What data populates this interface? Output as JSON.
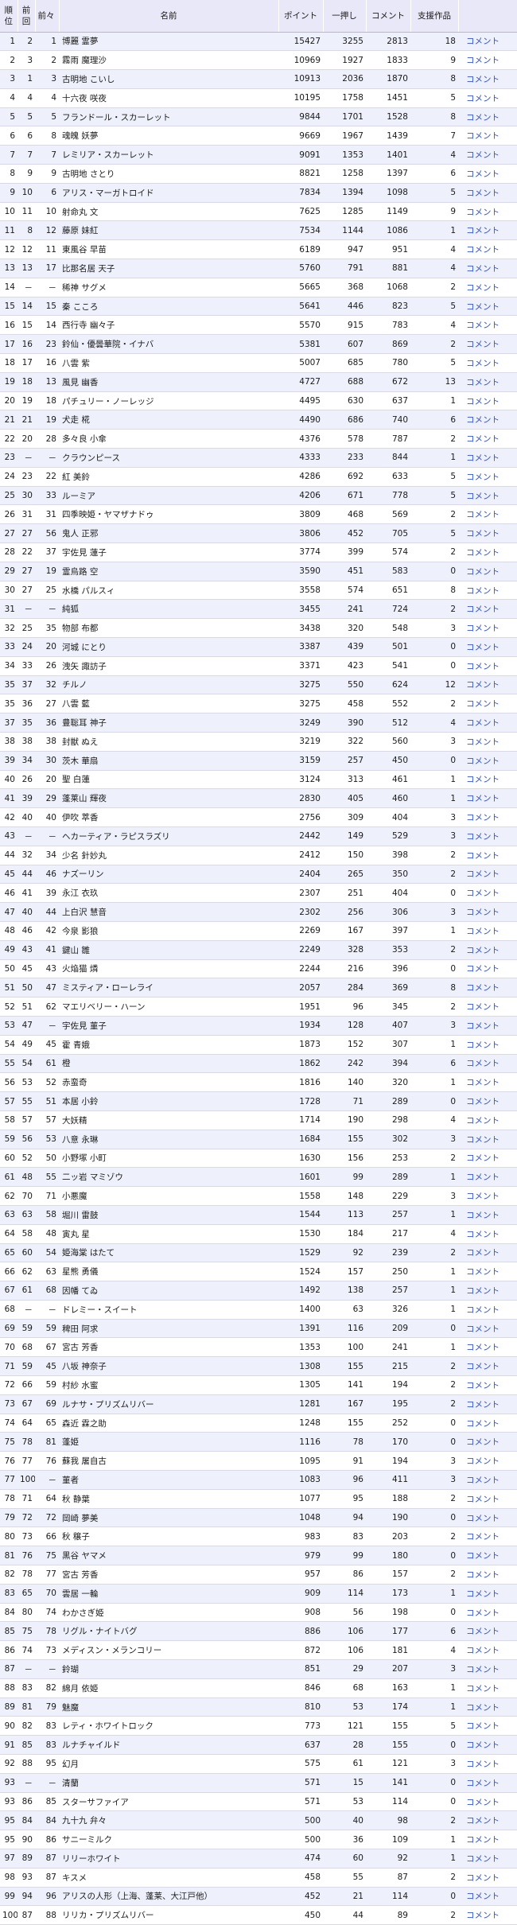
{
  "header": {
    "rank": "順位",
    "prev": "前回",
    "prev2": "前々",
    "name": "名前",
    "points": "ポイント",
    "push": "一押し",
    "comments": "コメント",
    "works": "支援作品"
  },
  "link_label": "コメント",
  "rows": [
    [
      "1",
      "2",
      "1",
      "博麗 霊夢",
      "15427",
      "3255",
      "2813",
      "18"
    ],
    [
      "2",
      "3",
      "2",
      "霧雨 魔理沙",
      "10969",
      "1927",
      "1833",
      "9"
    ],
    [
      "3",
      "1",
      "3",
      "古明地 こいし",
      "10913",
      "2036",
      "1870",
      "8"
    ],
    [
      "4",
      "4",
      "4",
      "十六夜 咲夜",
      "10195",
      "1758",
      "1451",
      "5"
    ],
    [
      "5",
      "5",
      "5",
      "フランドール・スカーレット",
      "9844",
      "1701",
      "1528",
      "8"
    ],
    [
      "6",
      "6",
      "8",
      "魂魄 妖夢",
      "9669",
      "1967",
      "1439",
      "7"
    ],
    [
      "7",
      "7",
      "7",
      "レミリア・スカーレット",
      "9091",
      "1353",
      "1401",
      "4"
    ],
    [
      "8",
      "9",
      "9",
      "古明地 さとり",
      "8821",
      "1258",
      "1397",
      "6"
    ],
    [
      "9",
      "10",
      "6",
      "アリス・マーガトロイド",
      "7834",
      "1394",
      "1098",
      "5"
    ],
    [
      "10",
      "11",
      "10",
      "射命丸 文",
      "7625",
      "1285",
      "1149",
      "9"
    ],
    [
      "11",
      "8",
      "12",
      "藤原 妹紅",
      "7534",
      "1144",
      "1086",
      "1"
    ],
    [
      "12",
      "12",
      "11",
      "東風谷 早苗",
      "6189",
      "947",
      "951",
      "4"
    ],
    [
      "13",
      "13",
      "17",
      "比那名居 天子",
      "5760",
      "791",
      "881",
      "4"
    ],
    [
      "14",
      "－",
      "－",
      "稀神 サグメ",
      "5665",
      "368",
      "1068",
      "2"
    ],
    [
      "15",
      "14",
      "15",
      "秦 こころ",
      "5641",
      "446",
      "823",
      "5"
    ],
    [
      "16",
      "15",
      "14",
      "西行寺 幽々子",
      "5570",
      "915",
      "783",
      "4"
    ],
    [
      "17",
      "16",
      "23",
      "鈴仙・優曇華院・イナバ",
      "5381",
      "607",
      "869",
      "2"
    ],
    [
      "18",
      "17",
      "16",
      "八雲 紫",
      "5007",
      "685",
      "780",
      "5"
    ],
    [
      "19",
      "18",
      "13",
      "風見 幽香",
      "4727",
      "688",
      "672",
      "13"
    ],
    [
      "20",
      "19",
      "18",
      "パチュリー・ノーレッジ",
      "4495",
      "630",
      "637",
      "1"
    ],
    [
      "21",
      "21",
      "19",
      "犬走 椛",
      "4490",
      "686",
      "740",
      "6"
    ],
    [
      "22",
      "20",
      "28",
      "多々良 小傘",
      "4376",
      "578",
      "787",
      "2"
    ],
    [
      "23",
      "－",
      "－",
      "クラウンピース",
      "4333",
      "233",
      "844",
      "1"
    ],
    [
      "24",
      "23",
      "22",
      "紅 美鈴",
      "4286",
      "692",
      "633",
      "5"
    ],
    [
      "25",
      "30",
      "33",
      "ルーミア",
      "4206",
      "671",
      "778",
      "5"
    ],
    [
      "26",
      "31",
      "31",
      "四季映姫・ヤマザナドゥ",
      "3809",
      "468",
      "569",
      "2"
    ],
    [
      "27",
      "27",
      "56",
      "鬼人 正邪",
      "3806",
      "452",
      "705",
      "5"
    ],
    [
      "28",
      "22",
      "37",
      "宇佐見 蓮子",
      "3774",
      "399",
      "574",
      "2"
    ],
    [
      "29",
      "27",
      "19",
      "霊烏路 空",
      "3590",
      "451",
      "583",
      "0"
    ],
    [
      "30",
      "27",
      "25",
      "水橋 パルスィ",
      "3558",
      "574",
      "651",
      "8"
    ],
    [
      "31",
      "－",
      "－",
      "純狐",
      "3455",
      "241",
      "724",
      "2"
    ],
    [
      "32",
      "25",
      "35",
      "物部 布都",
      "3438",
      "320",
      "548",
      "3"
    ],
    [
      "33",
      "24",
      "20",
      "河城 にとり",
      "3387",
      "439",
      "501",
      "0"
    ],
    [
      "34",
      "33",
      "26",
      "洩矢 諏訪子",
      "3371",
      "423",
      "541",
      "0"
    ],
    [
      "35",
      "37",
      "32",
      "チルノ",
      "3275",
      "550",
      "624",
      "12"
    ],
    [
      "35",
      "36",
      "27",
      "八雲 藍",
      "3275",
      "458",
      "552",
      "2"
    ],
    [
      "37",
      "35",
      "36",
      "豊聡耳 神子",
      "3249",
      "390",
      "512",
      "4"
    ],
    [
      "38",
      "38",
      "38",
      "封獣 ぬえ",
      "3219",
      "322",
      "560",
      "3"
    ],
    [
      "39",
      "34",
      "30",
      "茨木 華扇",
      "3159",
      "257",
      "450",
      "0"
    ],
    [
      "40",
      "26",
      "20",
      "聖 白蓮",
      "3124",
      "313",
      "461",
      "1"
    ],
    [
      "41",
      "39",
      "29",
      "蓬莱山 輝夜",
      "2830",
      "405",
      "460",
      "1"
    ],
    [
      "42",
      "40",
      "40",
      "伊吹 萃香",
      "2756",
      "309",
      "404",
      "3"
    ],
    [
      "43",
      "－",
      "－",
      "ヘカーティア・ラピスラズリ",
      "2442",
      "149",
      "529",
      "3"
    ],
    [
      "44",
      "32",
      "34",
      "少名 針妙丸",
      "2412",
      "150",
      "398",
      "2"
    ],
    [
      "45",
      "44",
      "46",
      "ナズーリン",
      "2404",
      "265",
      "350",
      "2"
    ],
    [
      "46",
      "41",
      "39",
      "永江 衣玖",
      "2307",
      "251",
      "404",
      "0"
    ],
    [
      "47",
      "40",
      "44",
      "上白沢 慧音",
      "2302",
      "256",
      "306",
      "3"
    ],
    [
      "48",
      "46",
      "42",
      "今泉 影狼",
      "2269",
      "167",
      "397",
      "1"
    ],
    [
      "49",
      "43",
      "41",
      "鍵山 雛",
      "2249",
      "328",
      "353",
      "2"
    ],
    [
      "50",
      "45",
      "43",
      "火焔猫 燐",
      "2244",
      "216",
      "396",
      "0"
    ],
    [
      "51",
      "50",
      "47",
      "ミスティア・ローレライ",
      "2057",
      "284",
      "369",
      "8"
    ],
    [
      "52",
      "51",
      "62",
      "マエリベリー・ハーン",
      "1951",
      "96",
      "345",
      "2"
    ],
    [
      "53",
      "47",
      "－",
      "宇佐見 菫子",
      "1934",
      "128",
      "407",
      "3"
    ],
    [
      "54",
      "49",
      "45",
      "霍 青娥",
      "1873",
      "152",
      "307",
      "1"
    ],
    [
      "55",
      "54",
      "61",
      "橙",
      "1862",
      "242",
      "394",
      "6"
    ],
    [
      "56",
      "53",
      "52",
      "赤蛮奇",
      "1816",
      "140",
      "320",
      "1"
    ],
    [
      "57",
      "55",
      "51",
      "本居 小鈴",
      "1728",
      "71",
      "289",
      "0"
    ],
    [
      "58",
      "57",
      "57",
      "大妖精",
      "1714",
      "190",
      "298",
      "4"
    ],
    [
      "59",
      "56",
      "53",
      "八意 永琳",
      "1684",
      "155",
      "302",
      "3"
    ],
    [
      "60",
      "52",
      "50",
      "小野塚 小町",
      "1630",
      "156",
      "253",
      "2"
    ],
    [
      "61",
      "48",
      "55",
      "二ッ岩 マミゾウ",
      "1601",
      "99",
      "289",
      "1"
    ],
    [
      "62",
      "70",
      "71",
      "小悪魔",
      "1558",
      "148",
      "229",
      "3"
    ],
    [
      "63",
      "63",
      "58",
      "堀川 雷鼓",
      "1544",
      "113",
      "257",
      "1"
    ],
    [
      "64",
      "58",
      "48",
      "寅丸 星",
      "1530",
      "184",
      "217",
      "4"
    ],
    [
      "65",
      "60",
      "54",
      "姫海棠 はたて",
      "1529",
      "92",
      "239",
      "2"
    ],
    [
      "66",
      "62",
      "63",
      "星熊 勇儀",
      "1524",
      "157",
      "250",
      "1"
    ],
    [
      "67",
      "61",
      "68",
      "因幡 てゐ",
      "1492",
      "138",
      "257",
      "1"
    ],
    [
      "68",
      "－",
      "－",
      "ドレミー・スイート",
      "1400",
      "63",
      "326",
      "1"
    ],
    [
      "69",
      "59",
      "59",
      "稗田 阿求",
      "1391",
      "116",
      "209",
      "0"
    ],
    [
      "70",
      "68",
      "67",
      "宮古 芳香",
      "1353",
      "100",
      "241",
      "1"
    ],
    [
      "71",
      "59",
      "45",
      "八坂 神奈子",
      "1308",
      "155",
      "215",
      "2"
    ],
    [
      "72",
      "66",
      "59",
      "村紗 水蜜",
      "1305",
      "141",
      "194",
      "2"
    ],
    [
      "73",
      "67",
      "69",
      "ルナサ・プリズムリバー",
      "1281",
      "167",
      "195",
      "2"
    ],
    [
      "74",
      "64",
      "65",
      "森近 霖之助",
      "1248",
      "155",
      "252",
      "0"
    ],
    [
      "75",
      "78",
      "81",
      "蓬姫",
      "1116",
      "78",
      "170",
      "0"
    ],
    [
      "76",
      "77",
      "76",
      "蘇我 屠自古",
      "1095",
      "91",
      "194",
      "3"
    ],
    [
      "77",
      "100",
      "－",
      "菫者",
      "1083",
      "96",
      "411",
      "3"
    ],
    [
      "78",
      "71",
      "64",
      "秋 静葉",
      "1077",
      "95",
      "188",
      "2"
    ],
    [
      "79",
      "72",
      "72",
      "岡崎 夢美",
      "1048",
      "94",
      "190",
      "0"
    ],
    [
      "80",
      "73",
      "66",
      "秋 穣子",
      "983",
      "83",
      "203",
      "2"
    ],
    [
      "81",
      "76",
      "75",
      "黒谷 ヤマメ",
      "979",
      "99",
      "180",
      "0"
    ],
    [
      "82",
      "78",
      "77",
      "宮古 芳香",
      "957",
      "86",
      "157",
      "2"
    ],
    [
      "83",
      "65",
      "70",
      "雲居 一輪",
      "909",
      "114",
      "173",
      "1"
    ],
    [
      "84",
      "80",
      "74",
      "わかさぎ姫",
      "908",
      "56",
      "198",
      "0"
    ],
    [
      "85",
      "75",
      "78",
      "リグル・ナイトバグ",
      "886",
      "106",
      "177",
      "6"
    ],
    [
      "86",
      "74",
      "73",
      "メディスン・メランコリー",
      "872",
      "106",
      "181",
      "4"
    ],
    [
      "87",
      "－",
      "－",
      "鈴瑚",
      "851",
      "29",
      "207",
      "3"
    ],
    [
      "88",
      "83",
      "82",
      "綿月 依姫",
      "846",
      "68",
      "163",
      "1"
    ],
    [
      "89",
      "81",
      "79",
      "魅魔",
      "810",
      "53",
      "174",
      "1"
    ],
    [
      "90",
      "82",
      "83",
      "レティ・ホワイトロック",
      "773",
      "121",
      "155",
      "5"
    ],
    [
      "91",
      "85",
      "83",
      "ルナチャイルド",
      "637",
      "28",
      "155",
      "0"
    ],
    [
      "92",
      "88",
      "95",
      "幻月",
      "575",
      "61",
      "121",
      "3"
    ],
    [
      "93",
      "－",
      "－",
      "清蘭",
      "571",
      "15",
      "141",
      "0"
    ],
    [
      "93",
      "86",
      "85",
      "スターサファイア",
      "571",
      "53",
      "114",
      "0"
    ],
    [
      "95",
      "84",
      "84",
      "九十九 弁々",
      "500",
      "40",
      "98",
      "2"
    ],
    [
      "95",
      "90",
      "86",
      "サニーミルク",
      "500",
      "36",
      "109",
      "1"
    ],
    [
      "97",
      "89",
      "87",
      "リリーホワイト",
      "474",
      "60",
      "92",
      "1"
    ],
    [
      "98",
      "93",
      "87",
      "キスメ",
      "458",
      "55",
      "87",
      "2"
    ],
    [
      "99",
      "94",
      "96",
      "アリスの人形（上海、蓬莱、大江戸他）",
      "452",
      "21",
      "114",
      "0"
    ],
    [
      "100",
      "87",
      "88",
      "リリカ・プリズムリバー",
      "450",
      "44",
      "89",
      "2"
    ]
  ]
}
